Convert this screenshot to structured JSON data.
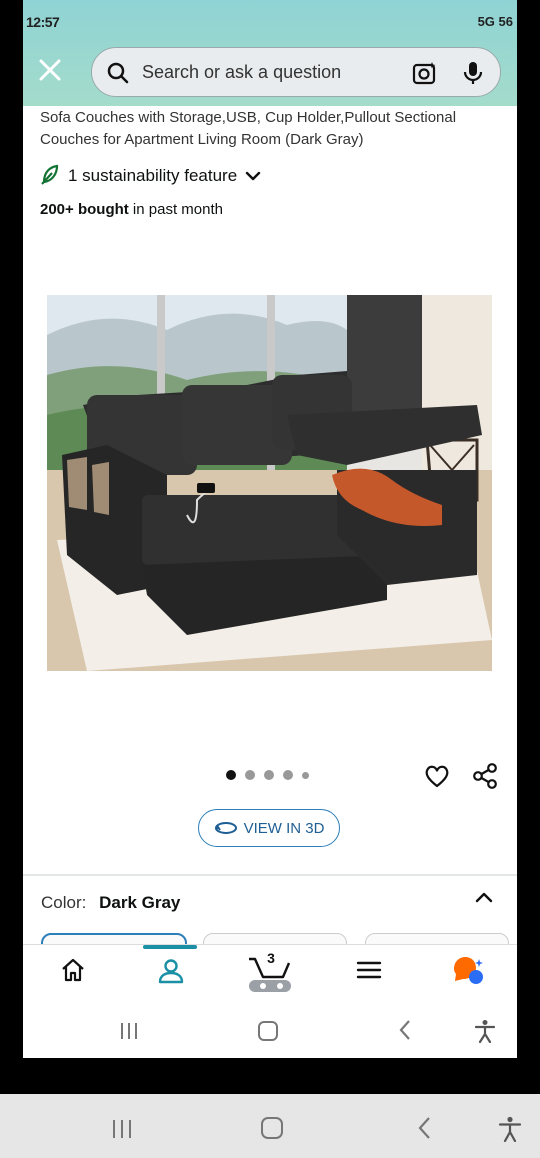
{
  "status_bar": {
    "time": "12:57",
    "icons_text": "5G 56"
  },
  "search": {
    "placeholder": "Search or ask a question"
  },
  "product": {
    "title": "Sofa Couches with Storage,USB, Cup Holder,Pullout Sectional Couches for Apartment Living Room (Dark Gray)",
    "sustainability_label": "1 sustainability feature",
    "bought_count": "200+ bought",
    "bought_suffix": " in past month",
    "image_count": 5,
    "active_image": 1
  },
  "actions": {
    "view_3d_label": "VIEW IN 3D"
  },
  "color": {
    "label": "Color:",
    "value": "Dark Gray"
  },
  "bottom_nav": {
    "items": [
      "home",
      "account",
      "cart",
      "menu",
      "rufus"
    ],
    "cart_count": "3",
    "active": "account"
  },
  "colors": {
    "accent": "#1a8fa5",
    "header": "#8fd3d4",
    "link": "#1f5f93"
  }
}
